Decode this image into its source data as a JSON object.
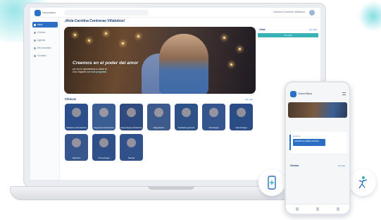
{
  "app": {
    "logo_text": "Clínica Ribera",
    "user_name": "Carolina Contreras Villalobos"
  },
  "sidebar": {
    "items": [
      {
        "label": "Inicio",
        "active": true
      },
      {
        "label": "Clínicas",
        "active": false
      },
      {
        "label": "Agenda",
        "active": false
      },
      {
        "label": "Mis consultas",
        "active": false
      },
      {
        "label": "Contacto",
        "active": false
      }
    ]
  },
  "greeting": "¡Hola Carolina Contreras Villalobos!",
  "hero": {
    "title": "Creemos en el poder del amor",
    "subtitle_pre": "por eso te ayudaremos a cuidar en",
    "subtitle_mid": "a tus hogares con",
    "subtitle_highlight": "este programa"
  },
  "right_panel": {
    "title": "Citas",
    "link": "Ver todo",
    "chip": "Ver citas"
  },
  "clinics": {
    "title": "Clínicas",
    "link": "Ver más",
    "tiles": [
      {
        "label": "Medicina ambulatoria",
        "color": "#2b4f8a"
      },
      {
        "label": "Urgencia ambulatoria",
        "color": "#3a5d94"
      },
      {
        "label": "Ginecología obstetricia",
        "color": "#2e4a7e"
      },
      {
        "label": "Diagnóstico",
        "color": "#3d5a8c"
      },
      {
        "label": "Pediatría general",
        "color": "#2d5288"
      },
      {
        "label": "Psicología",
        "color": "#34558e"
      },
      {
        "label": "Odontología",
        "color": "#2b4d86"
      },
      {
        "label": "Nutrición",
        "color": "#36568d"
      },
      {
        "label": "Kinesiología",
        "color": "#2f4f88"
      },
      {
        "label": "Mental",
        "color": "#31518a"
      }
    ]
  },
  "bubbles": [
    {
      "icon": "phone-plus-icon"
    },
    {
      "icon": "head-brain-icon"
    },
    {
      "icon": "tooth-icon"
    },
    {
      "icon": "physio-person-icon"
    }
  ],
  "phone": {
    "logo_text": "Clínica Ribera",
    "card_title": "Hola de",
    "card_text": "URGENCIA AMBULATORIA",
    "section_title": "Clínicas",
    "section_link": "Ver más"
  }
}
